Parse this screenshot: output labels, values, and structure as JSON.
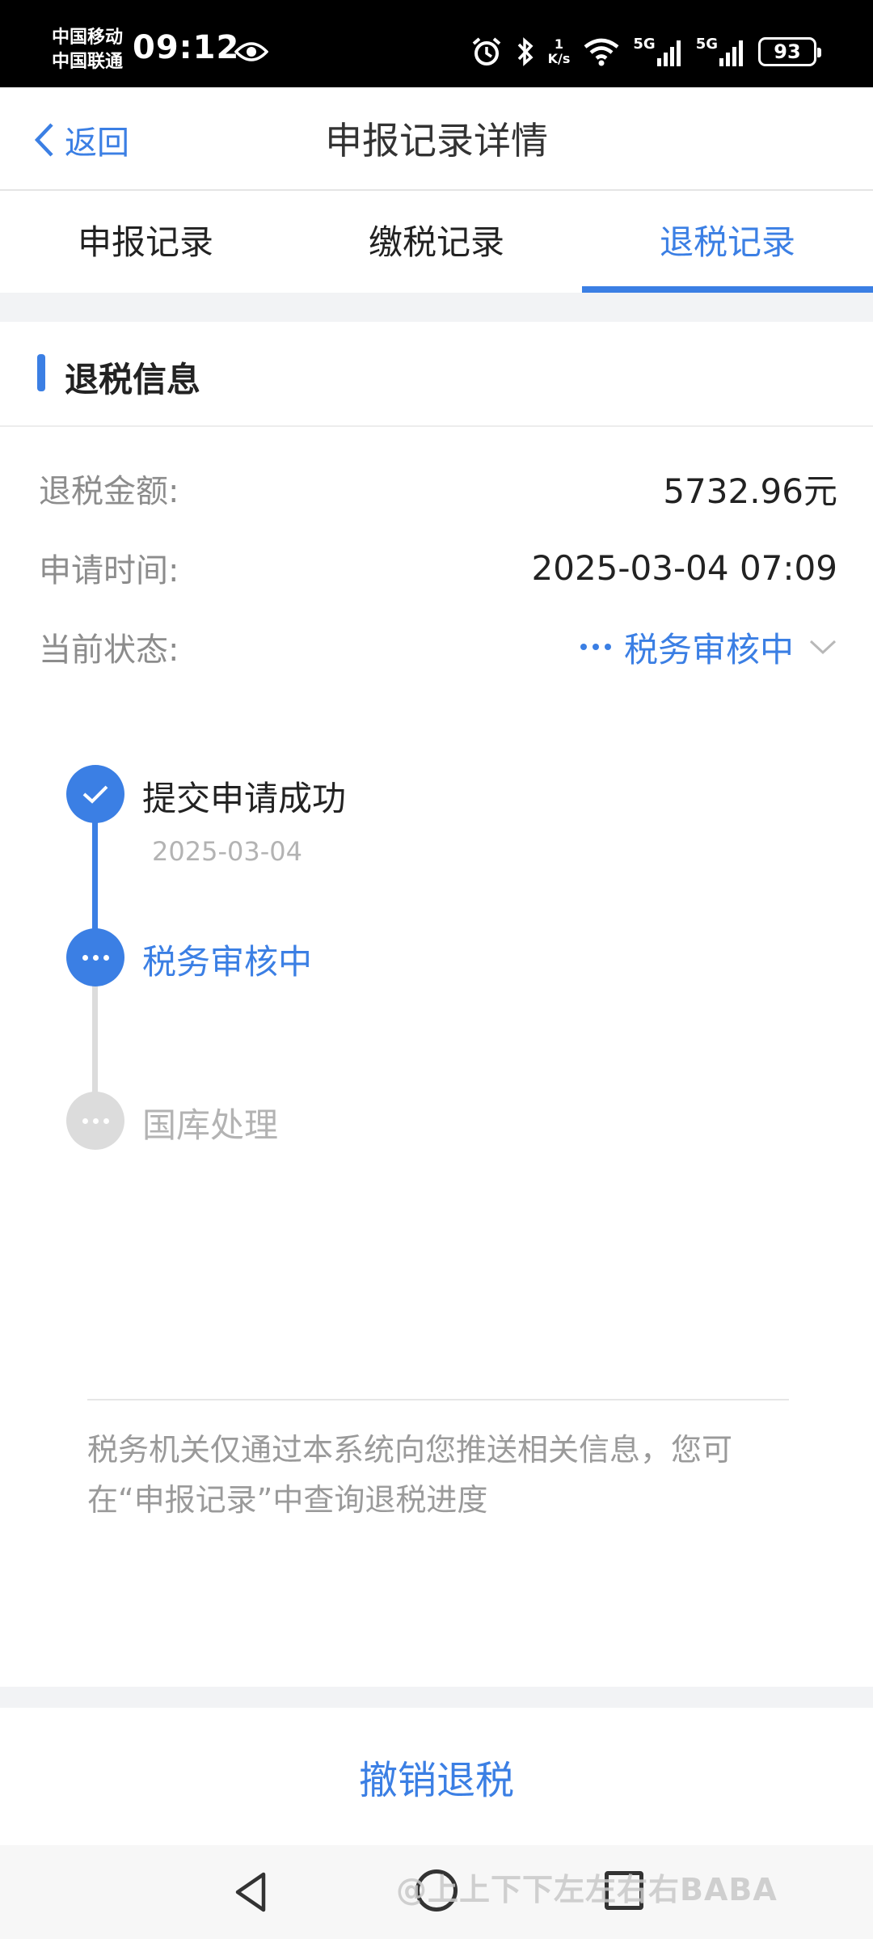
{
  "status_bar": {
    "carrier1": "中国移动",
    "carrier2": "中国联通",
    "time": "09:12",
    "speed_value": "1",
    "speed_unit": "K/s",
    "signal1_label": "5G",
    "signal2_label": "5G",
    "battery": "93"
  },
  "nav": {
    "back_label": "返回",
    "title": "申报记录详情"
  },
  "tabs": [
    {
      "label": "申报记录",
      "active": false
    },
    {
      "label": "缴税记录",
      "active": false
    },
    {
      "label": "退税记录",
      "active": true
    }
  ],
  "section": {
    "title": "退税信息"
  },
  "info": {
    "amount_label": "退税金额:",
    "amount_value": "5732.96元",
    "time_label": "申请时间:",
    "time_value": "2025-03-04 07:09",
    "status_label": "当前状态:",
    "status_value": "税务审核中"
  },
  "timeline": [
    {
      "title": "提交申请成功",
      "date": "2025-03-04",
      "state": "done"
    },
    {
      "title": "税务审核中",
      "date": "",
      "state": "current"
    },
    {
      "title": "国库处理",
      "date": "",
      "state": "pending"
    }
  ],
  "notice": "税务机关仅通过本系统向您推送相关信息，您可在“申报记录”中查询退税进度",
  "cancel_label": "撤销退税",
  "watermark": "@上上下下左左右右BABA",
  "colors": {
    "accent": "#3b7fe4",
    "muted": "#8c8c8c",
    "pending": "#dcdcdc"
  }
}
